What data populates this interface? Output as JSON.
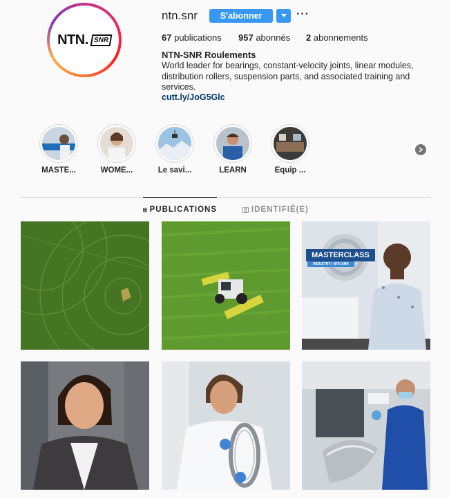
{
  "profile": {
    "username": "ntn.snr",
    "follow_label": "S'abonner",
    "more_label": "···",
    "logo_main": "NTN.",
    "logo_secondary": "SNR",
    "stats": {
      "posts": "67",
      "posts_label": "publications",
      "followers": "957",
      "followers_label": "abonnés",
      "following": "2",
      "following_label": "abonnements"
    },
    "full_name": "NTN-SNR Roulements",
    "bio": "World leader for bearings, constant-velocity joints, linear modules, distribution rollers, suspension parts, and associated training and services.",
    "link": "cutt.ly/JoG5Glc"
  },
  "highlights": [
    {
      "label": "MASTE..."
    },
    {
      "label": "WOME..."
    },
    {
      "label": "Le savi..."
    },
    {
      "label": "LEARN"
    },
    {
      "label": "Equip ..."
    }
  ],
  "tabs": {
    "publications": "PUBLICATIONS",
    "tagged": "IDENTIFIÉ(E)"
  },
  "posts": [
    {
      "name": "post-crop-field",
      "caption": ""
    },
    {
      "name": "post-tractor",
      "caption": ""
    },
    {
      "name": "post-masterclass",
      "caption": "MASTERCLASS",
      "sub": "INDUSTRY | NTN SNR"
    },
    {
      "name": "post-woman-portrait",
      "caption": ""
    },
    {
      "name": "post-lab-bearing",
      "caption": ""
    },
    {
      "name": "post-factory-worker",
      "caption": ""
    }
  ],
  "colors": {
    "follow_blue": "#3897f0",
    "link_blue": "#00376b",
    "text": "#262626",
    "muted": "#8e8e8e",
    "divider": "#dbdbdb"
  }
}
